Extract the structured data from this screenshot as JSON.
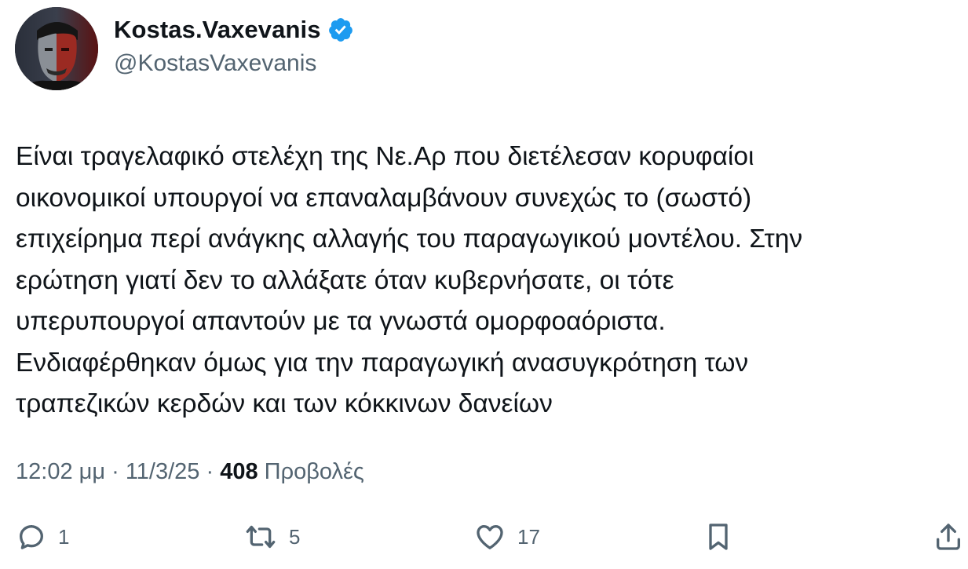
{
  "author": {
    "display_name": "Kostas.Vaxevanis",
    "handle": "@KostasVaxevanis",
    "verified": true,
    "verified_icon": "verified-badge-icon",
    "verified_color": "#1d9bf0",
    "avatar_icon": "profile-avatar"
  },
  "tweet": {
    "text": "Είναι τραγελαφικό στελέχη της Νε.Αρ που διετέλεσαν κορυφαίοι\nοικονομικοί υπουργοί να επαναλαμβάνουν συνεχώς το (σωστό)\nεπιχείρημα περί ανάγκης αλλαγής του παραγωγικού μοντέλου. Στην\nερώτηση γιατί δεν το αλλάξατε όταν κυβερνήσατε, οι τότε\nυπερυπουργοί απαντούν με τα γνωστά ομορφοαόριστα.\nΕνδιαφέρθηκαν όμως για την παραγωγική ανασυγκρότηση των\nτραπεζικών κερδών και των κόκκινων δανείων"
  },
  "meta": {
    "time": "12:02 μμ",
    "separator": " · ",
    "date": "11/3/25",
    "views_count": "408",
    "views_label": "Προβολές"
  },
  "actions": {
    "reply": {
      "icon": "reply-icon",
      "count": "1"
    },
    "retweet": {
      "icon": "retweet-icon",
      "count": "5"
    },
    "like": {
      "icon": "heart-icon",
      "count": "17"
    },
    "bookmark": {
      "icon": "bookmark-icon"
    },
    "share": {
      "icon": "share-icon"
    }
  },
  "colors": {
    "text_primary": "#0f1419",
    "text_secondary": "#536471",
    "accent": "#1d9bf0"
  }
}
